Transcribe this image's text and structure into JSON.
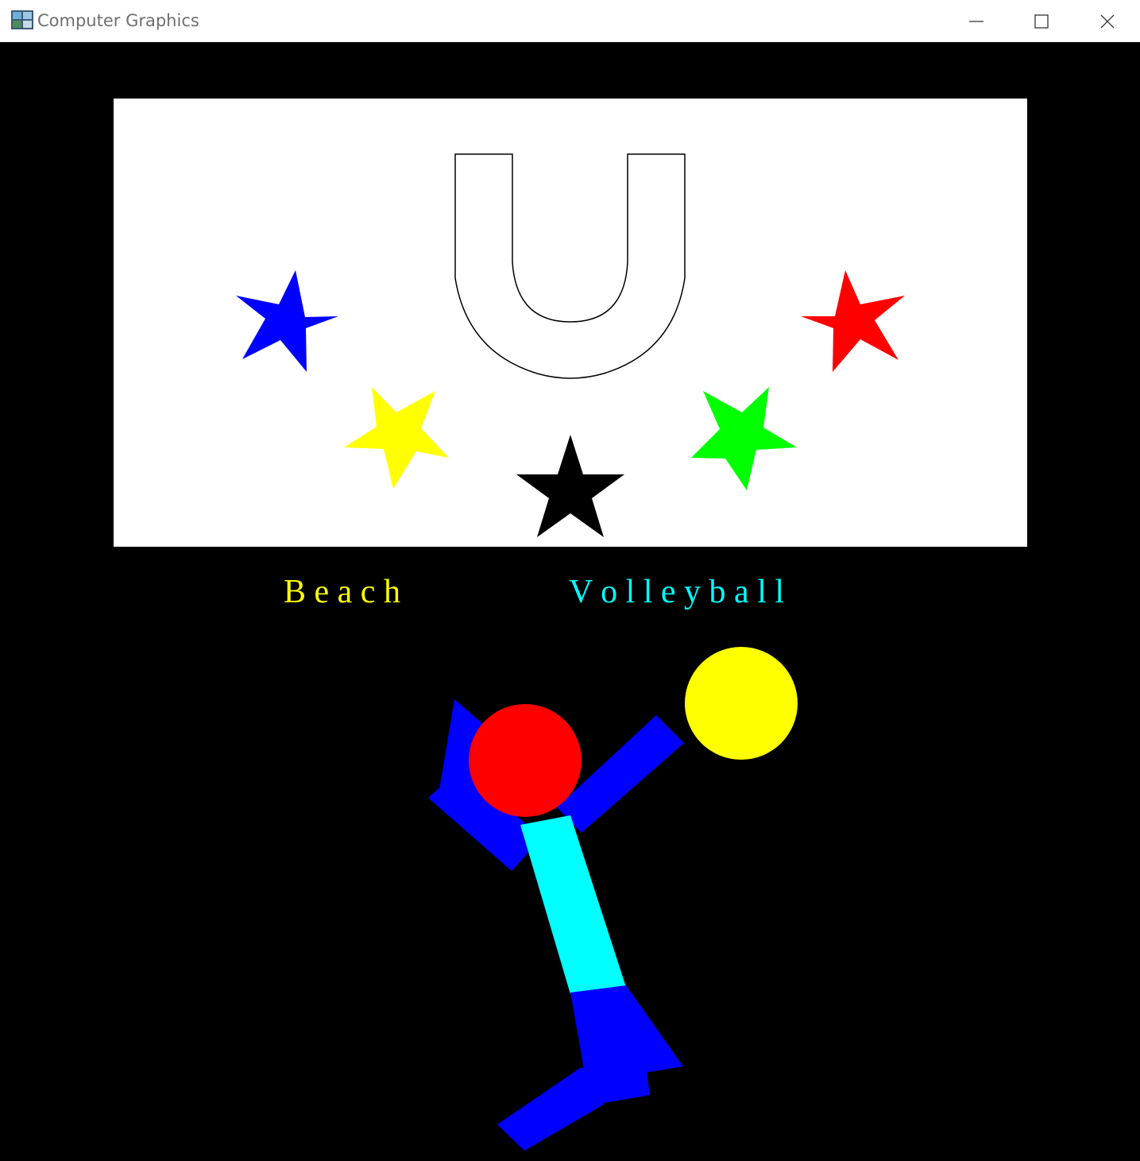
{
  "window": {
    "title": "Computer Graphics",
    "controls": {
      "minimize": "minimize-icon",
      "maximize": "maximize-icon",
      "close": "close-icon"
    }
  },
  "scene": {
    "banner_background": "#ffffff",
    "canvas_background": "#000000",
    "letter": "U",
    "stars": [
      {
        "name": "blue",
        "color": "#0000ff"
      },
      {
        "name": "yellow",
        "color": "#ffff00"
      },
      {
        "name": "black",
        "color": "#000000"
      },
      {
        "name": "green",
        "color": "#00ff00"
      },
      {
        "name": "red",
        "color": "#ff0000"
      }
    ],
    "caption": {
      "word1": "B e a c h",
      "word1_color": "#ffff00",
      "word2": "V o l l e y b a l l",
      "word2_color": "#00ffff"
    },
    "player": {
      "head_color": "#ff0000",
      "torso_color": "#00ffff",
      "limbs_color": "#0000ff"
    },
    "ball_color": "#ffff00"
  }
}
